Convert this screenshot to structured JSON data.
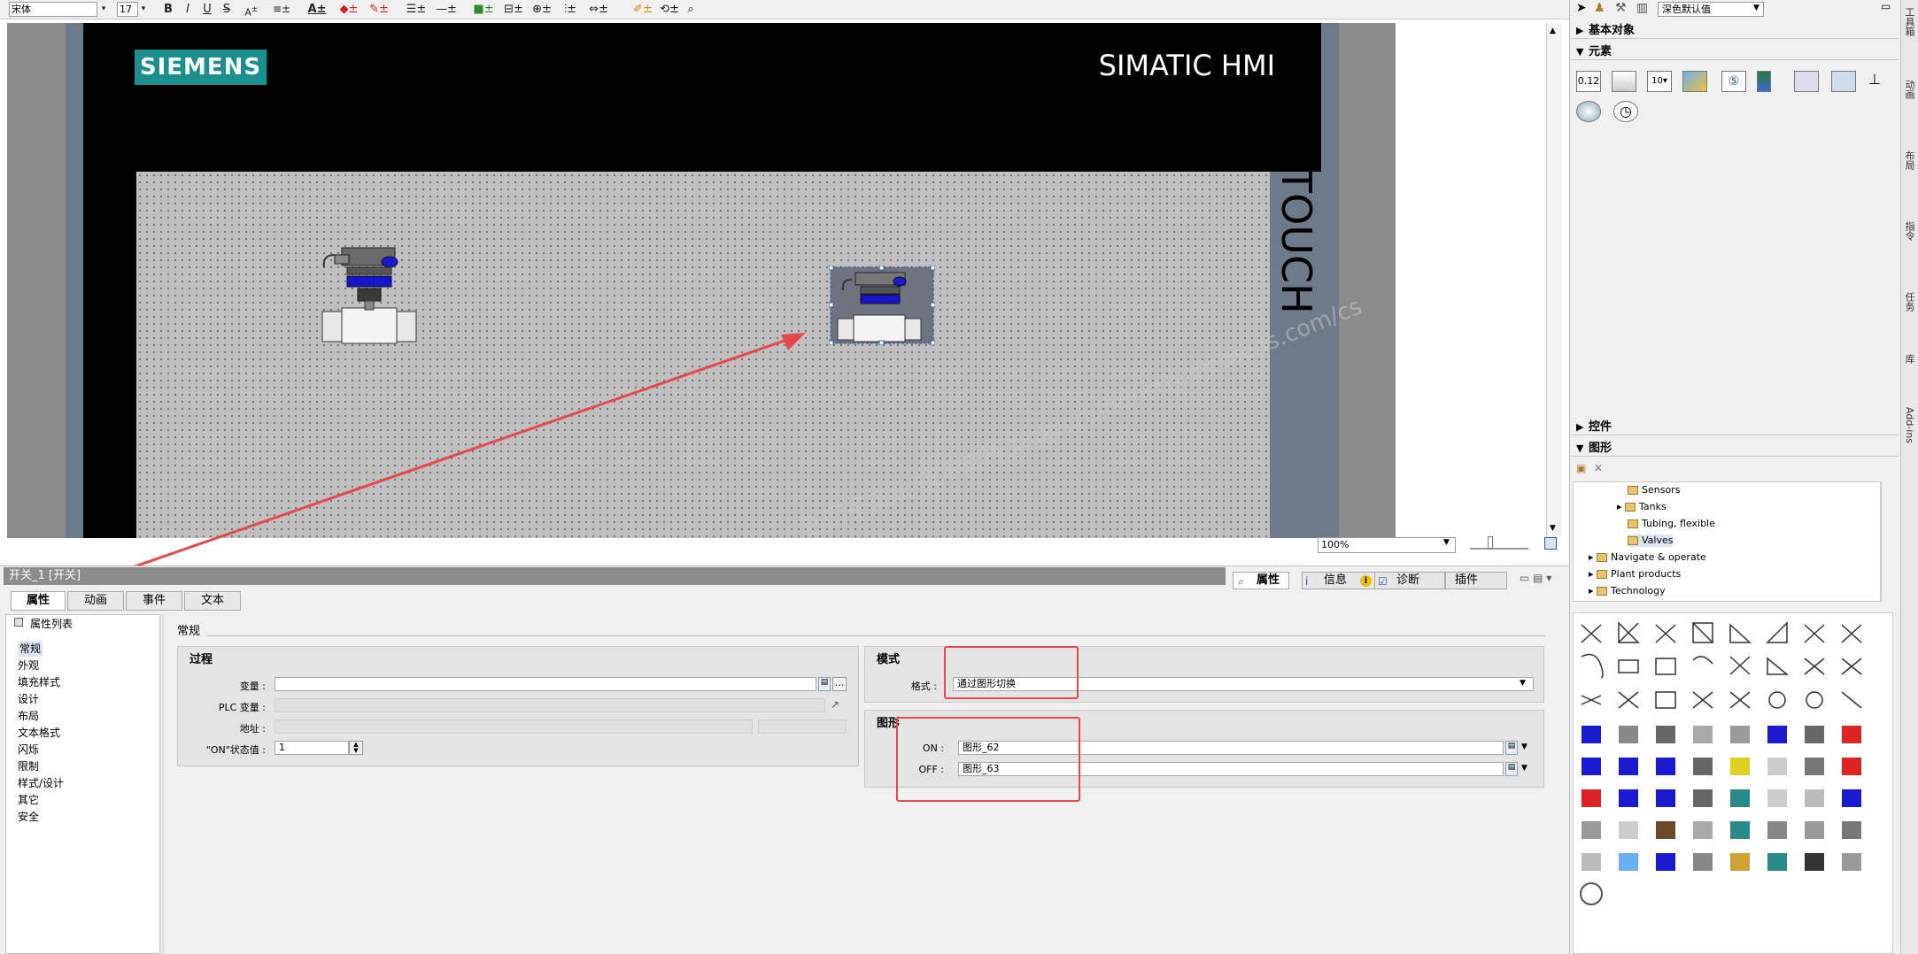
{
  "toolbar": {
    "font_name": "宋体",
    "font_size": "17",
    "bold": "B",
    "italic": "I",
    "underline": "U",
    "strike": "S"
  },
  "canvas": {
    "brand_logo": "SIEMENS",
    "device_title": "SIMATIC HMI",
    "touch_label": "TOUCH",
    "zoom": "100%",
    "watermark": "西门子工业 技术支持 support.industry.siemens.com/cs"
  },
  "properties": {
    "object_title": "开关_1 [开关]",
    "inspector_tabs": [
      "属性",
      "信息",
      "诊断",
      "插件"
    ],
    "prop_tabs": [
      "属性",
      "动画",
      "事件",
      "文本"
    ],
    "prop_list_header": "属性列表",
    "nav_items": [
      "常规",
      "外观",
      "填充样式",
      "设计",
      "布局",
      "文本格式",
      "闪烁",
      "限制",
      "样式/设计",
      "其它",
      "安全"
    ],
    "section_heading": "常规",
    "process": {
      "title": "过程",
      "tag_label": "变量 :",
      "plc_tag_label": "PLC 变量 :",
      "address_label": "地址 :",
      "on_value_label": "\"ON\"状态值 :",
      "on_value": "1"
    },
    "mode": {
      "title": "模式",
      "format_label": "格式 :",
      "format_value": "通过图形切换"
    },
    "graphic": {
      "title": "图形",
      "on_label": "ON :",
      "on_value": "图形_62",
      "off_label": "OFF :",
      "off_value": "图形_63"
    }
  },
  "toolbox": {
    "style_select": "深色默认值",
    "basic_objects": "基本对象",
    "elements": "元素",
    "controls": "控件",
    "graphics": "图形",
    "tree": [
      "Sensors",
      "Tanks",
      "Tubing, flexible",
      "Valves",
      "Navigate & operate",
      "Plant products",
      "Technology"
    ],
    "side_tabs": [
      "工具箱",
      "动画",
      "布局",
      "指令",
      "任务",
      "库",
      "Add-ins"
    ]
  },
  "colors": {
    "siemens_teal": "#1b8f8d",
    "frame_blue_gray": "#6c7a89",
    "annotation_red": "#e5484d"
  }
}
